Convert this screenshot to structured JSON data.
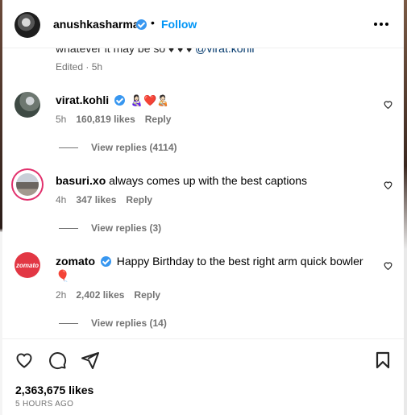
{
  "header": {
    "username": "anushkasharma",
    "separator": "•",
    "follow_label": "Follow"
  },
  "caption": {
    "tail_text": "whatever it may be so ♦ ♦ ♦",
    "mention": "@virat.kohli",
    "edited": "Edited · 5h"
  },
  "comments": [
    {
      "username": "virat.kohli",
      "verified": true,
      "text": "👩🏻‍🍼❤️🧑🏻‍🍼",
      "time": "5h",
      "likes": "160,819 likes",
      "reply": "Reply",
      "view_replies": "View replies (4114)"
    },
    {
      "username": "basuri.xo",
      "verified": false,
      "text": "always comes up with the best captions",
      "time": "4h",
      "likes": "347 likes",
      "reply": "Reply",
      "view_replies": "View replies (3)"
    },
    {
      "username": "zomato",
      "verified": true,
      "text": "Happy Birthday to the best right arm quick bowler 🎈",
      "time": "2h",
      "likes": "2,402 likes",
      "reply": "Reply",
      "view_replies": "View replies (14)",
      "avatar_text": "zomato"
    }
  ],
  "footer": {
    "likes_total": "2,363,675 likes",
    "time_ago": "5 HOURS AGO"
  },
  "icons": [
    "heart-icon",
    "comment-icon",
    "share-icon",
    "bookmark-icon",
    "more-options-icon",
    "verified-badge-icon"
  ],
  "colors": {
    "accent": "#0095f6",
    "verified": "#3897f0",
    "mention": "#00376b",
    "muted": "#737373",
    "zomato_red": "#e23744"
  }
}
